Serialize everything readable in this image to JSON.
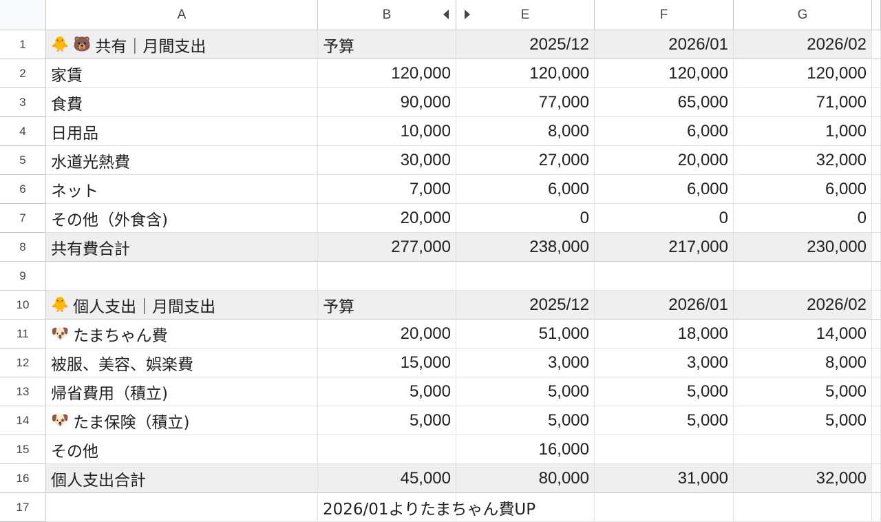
{
  "columns": [
    "A",
    "B",
    "E",
    "F",
    "G"
  ],
  "icons": {
    "chick": "🐥",
    "bear": "🐻",
    "dog": "🐶"
  },
  "rows": [
    {
      "n": "1",
      "icons": [
        "chick",
        "bear"
      ],
      "a": "共有｜月間支出",
      "b": "予算",
      "e": "2025/12",
      "f": "2026/01",
      "g": "2026/02"
    },
    {
      "n": "2",
      "a": "家賃",
      "b": "120,000",
      "e": "120,000",
      "f": "120,000",
      "g": "120,000"
    },
    {
      "n": "3",
      "a": "食費",
      "b": "90,000",
      "e": "77,000",
      "f": "65,000",
      "g": "71,000"
    },
    {
      "n": "4",
      "a": "日用品",
      "b": "10,000",
      "e": "8,000",
      "f": "6,000",
      "g": "1,000"
    },
    {
      "n": "5",
      "a": "水道光熱費",
      "b": "30,000",
      "e": "27,000",
      "f": "20,000",
      "g": "32,000"
    },
    {
      "n": "6",
      "a": "ネット",
      "b": "7,000",
      "e": "6,000",
      "f": "6,000",
      "g": "6,000"
    },
    {
      "n": "7",
      "a": "その他（外食含)",
      "b": "20,000",
      "e": "0",
      "f": "0",
      "g": "0"
    },
    {
      "n": "8",
      "a": "共有費合計",
      "b": "277,000",
      "e": "238,000",
      "f": "217,000",
      "g": "230,000"
    },
    {
      "n": "9",
      "a": "",
      "b": "",
      "e": "",
      "f": "",
      "g": ""
    },
    {
      "n": "10",
      "icons": [
        "chick"
      ],
      "a": "個人支出｜月間支出",
      "b": "予算",
      "e": "2025/12",
      "f": "2026/01",
      "g": "2026/02"
    },
    {
      "n": "11",
      "icons": [
        "dog"
      ],
      "a": "たまちゃん費",
      "b": "20,000",
      "e": "51,000",
      "f": "18,000",
      "g": "14,000"
    },
    {
      "n": "12",
      "a": "被服、美容、娯楽費",
      "b": "15,000",
      "e": "3,000",
      "f": "3,000",
      "g": "8,000"
    },
    {
      "n": "13",
      "a": "帰省費用（積立)",
      "b": "5,000",
      "e": "5,000",
      "f": "5,000",
      "g": "5,000"
    },
    {
      "n": "14",
      "icons": [
        "dog"
      ],
      "a": "たま保険（積立)",
      "b": "5,000",
      "e": "5,000",
      "f": "5,000",
      "g": "5,000"
    },
    {
      "n": "15",
      "a": "その他",
      "b": "",
      "e": "16,000",
      "f": "",
      "g": ""
    },
    {
      "n": "16",
      "a": "個人支出合計",
      "b": "45,000",
      "e": "80,000",
      "f": "31,000",
      "g": "32,000"
    },
    {
      "n": "17",
      "a": "",
      "b": "2026/01よりたまちゃん費UP",
      "e": "",
      "f": "",
      "g": ""
    }
  ]
}
